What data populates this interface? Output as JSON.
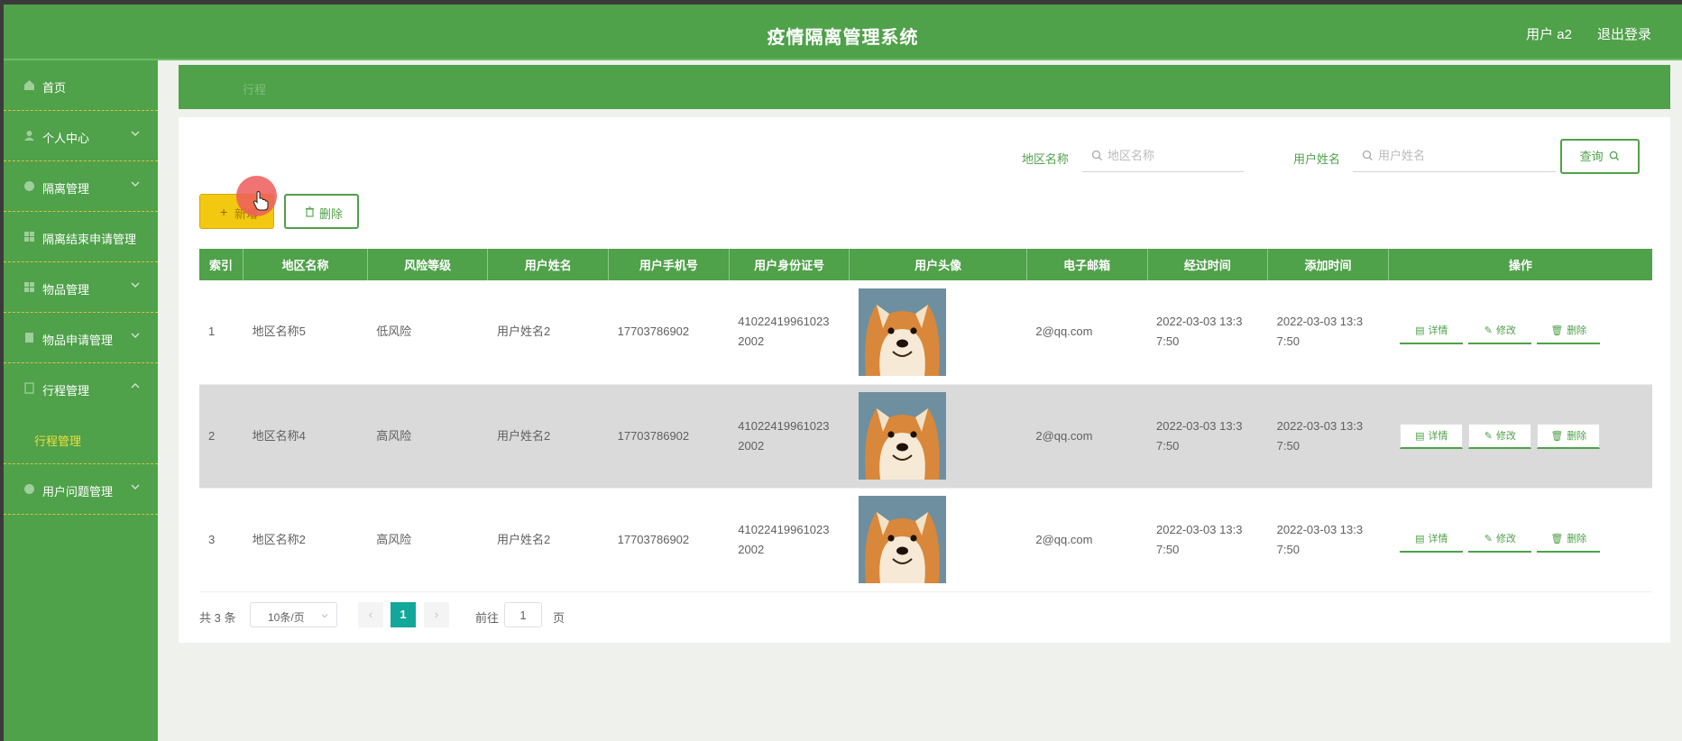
{
  "header": {
    "title": "疫情隔离管理系统",
    "user": "用户 a2",
    "logout": "退出登录"
  },
  "sidebar": {
    "items": [
      {
        "label": "首页",
        "icon": "home-icon",
        "expandable": false
      },
      {
        "label": "个人中心",
        "icon": "person-icon",
        "expandable": true
      },
      {
        "label": "隔离管理",
        "icon": "grid-icon",
        "expandable": true
      },
      {
        "label": "隔离结束申请管理",
        "icon": "grid-icon",
        "expandable": false
      },
      {
        "label": "物品管理",
        "icon": "grid-icon",
        "expandable": true
      },
      {
        "label": "物品申请管理",
        "icon": "doc-icon",
        "expandable": true
      },
      {
        "label": "行程管理",
        "icon": "doc-icon",
        "expandable": true,
        "open": true
      },
      {
        "label": "用户问题管理",
        "icon": "grid-icon",
        "expandable": true
      }
    ],
    "sub_item": "行程管理"
  },
  "breadcrumb": "行程",
  "search": {
    "region_label": "地区名称",
    "region_placeholder": "地区名称",
    "user_label": "用户姓名",
    "user_placeholder": "用户姓名",
    "query_button": "查询"
  },
  "toolbar": {
    "add_label": "新增",
    "delete_label": "删除"
  },
  "table": {
    "columns": [
      "索引",
      "地区名称",
      "风险等级",
      "用户姓名",
      "用户手机号",
      "用户身份证号",
      "用户头像",
      "电子邮箱",
      "经过时间",
      "添加时间",
      "操作"
    ],
    "rows": [
      {
        "index": "1",
        "region": "地区名称5",
        "risk": "低风险",
        "name": "用户姓名2",
        "phone": "17703786902",
        "id_line1": "41022419961023",
        "id_line2": "2002",
        "email": "2@qq.com",
        "pass_line1": "2022-03-03 13:3",
        "pass_line2": "7:50",
        "add_line1": "2022-03-03 13:3",
        "add_line2": "7:50"
      },
      {
        "index": "2",
        "region": "地区名称4",
        "risk": "高风险",
        "name": "用户姓名2",
        "phone": "17703786902",
        "id_line1": "41022419961023",
        "id_line2": "2002",
        "email": "2@qq.com",
        "pass_line1": "2022-03-03 13:3",
        "pass_line2": "7:50",
        "add_line1": "2022-03-03 13:3",
        "add_line2": "7:50"
      },
      {
        "index": "3",
        "region": "地区名称2",
        "risk": "高风险",
        "name": "用户姓名2",
        "phone": "17703786902",
        "id_line1": "41022419961023",
        "id_line2": "2002",
        "email": "2@qq.com",
        "pass_line1": "2022-03-03 13:3",
        "pass_line2": "7:50",
        "add_line1": "2022-03-03 13:3",
        "add_line2": "7:50"
      }
    ],
    "actions": {
      "detail": "详情",
      "edit": "修改",
      "delete": "删除"
    }
  },
  "pagination": {
    "total": "共 3 条",
    "page_size": "10条/页",
    "current_page": "1",
    "goto_prefix": "前往",
    "goto_value": "1",
    "goto_suffix": "页"
  },
  "colors": {
    "primary": "#4fa14a",
    "accent_yellow": "#f2c811",
    "page_active": "#11a79a"
  }
}
